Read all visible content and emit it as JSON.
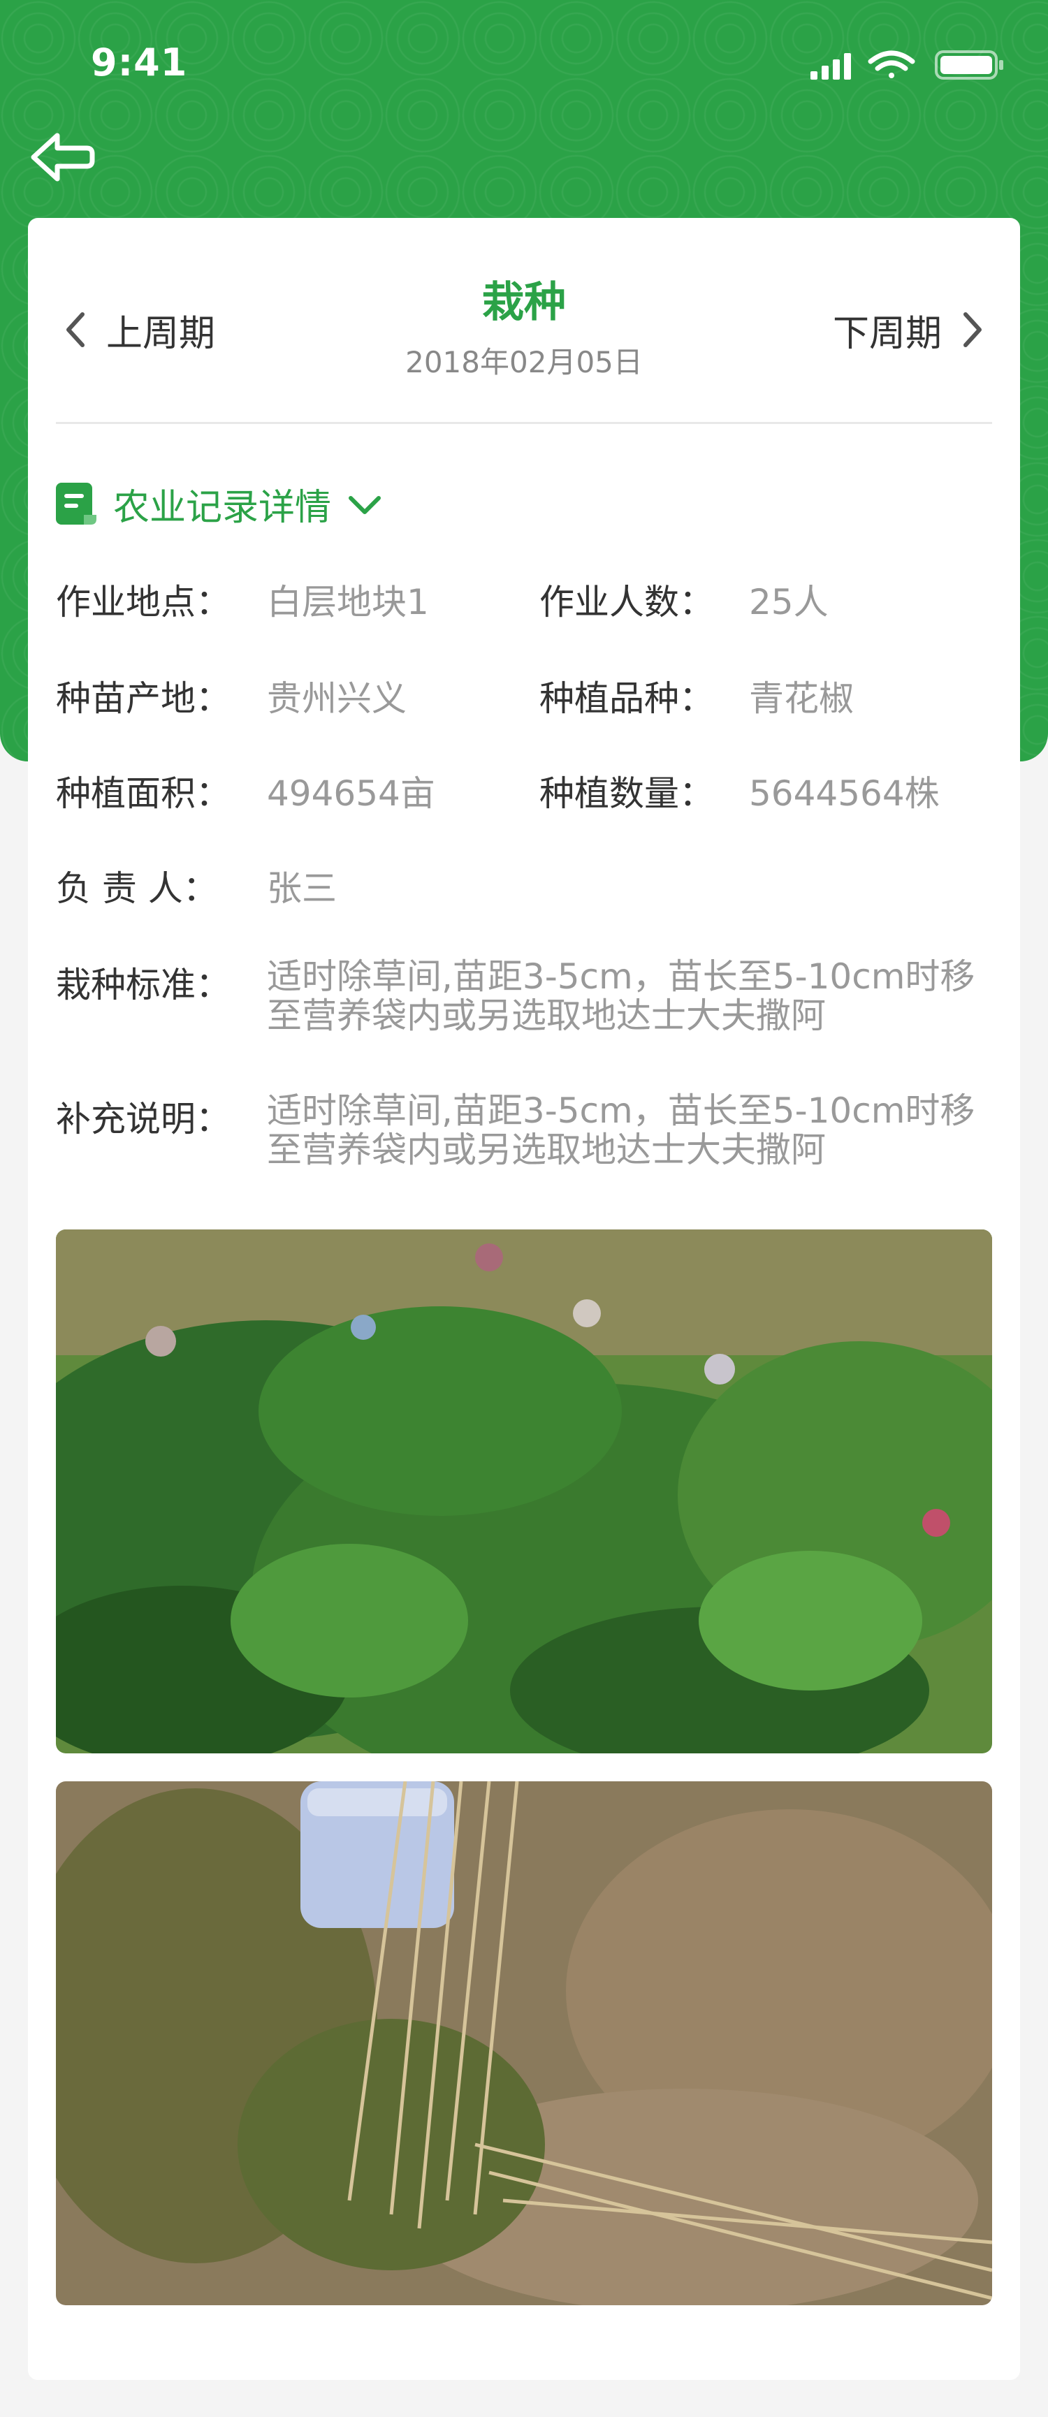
{
  "status_bar": {
    "time": "9:41"
  },
  "header": {
    "title": "栽种",
    "date": "2018年02月05日"
  },
  "nav": {
    "prev_label": "上周期",
    "next_label": "下周期"
  },
  "section": {
    "title": "农业记录详情"
  },
  "details": {
    "location_label": "作业地点：",
    "location_value": "白层地块1",
    "workers_label": "作业人数：",
    "workers_value": "25人",
    "origin_label": "种苗产地：",
    "origin_value": "贵州兴义",
    "variety_label": "种植品种：",
    "variety_value": "青花椒",
    "area_label": "种植面积：",
    "area_value": "494654亩",
    "quantity_label": "种植数量：",
    "quantity_value": "5644564株",
    "manager_label": "负 责 人：",
    "manager_value": "张三",
    "standard_label": "栽种标准：",
    "standard_value": "适时除草间,苗距3-5cm，苗长至5-10cm时移至营养袋内或另选取地达士大夫撒阿",
    "notes_label": "补充说明：",
    "notes_value": "适时除草间,苗距3-5cm，苗长至5-10cm时移至营养袋内或另选取地达士大夫撒阿"
  },
  "colors": {
    "brand": "#2ba247",
    "label": "#333333",
    "value": "#999999"
  },
  "icons": {
    "back": "back-arrow-icon",
    "prev": "chevron-left-icon",
    "next": "chevron-right-icon",
    "record": "record-book-icon",
    "expand": "chevron-down-icon",
    "signal": "cellular-signal-icon",
    "wifi": "wifi-icon",
    "battery": "battery-icon"
  }
}
